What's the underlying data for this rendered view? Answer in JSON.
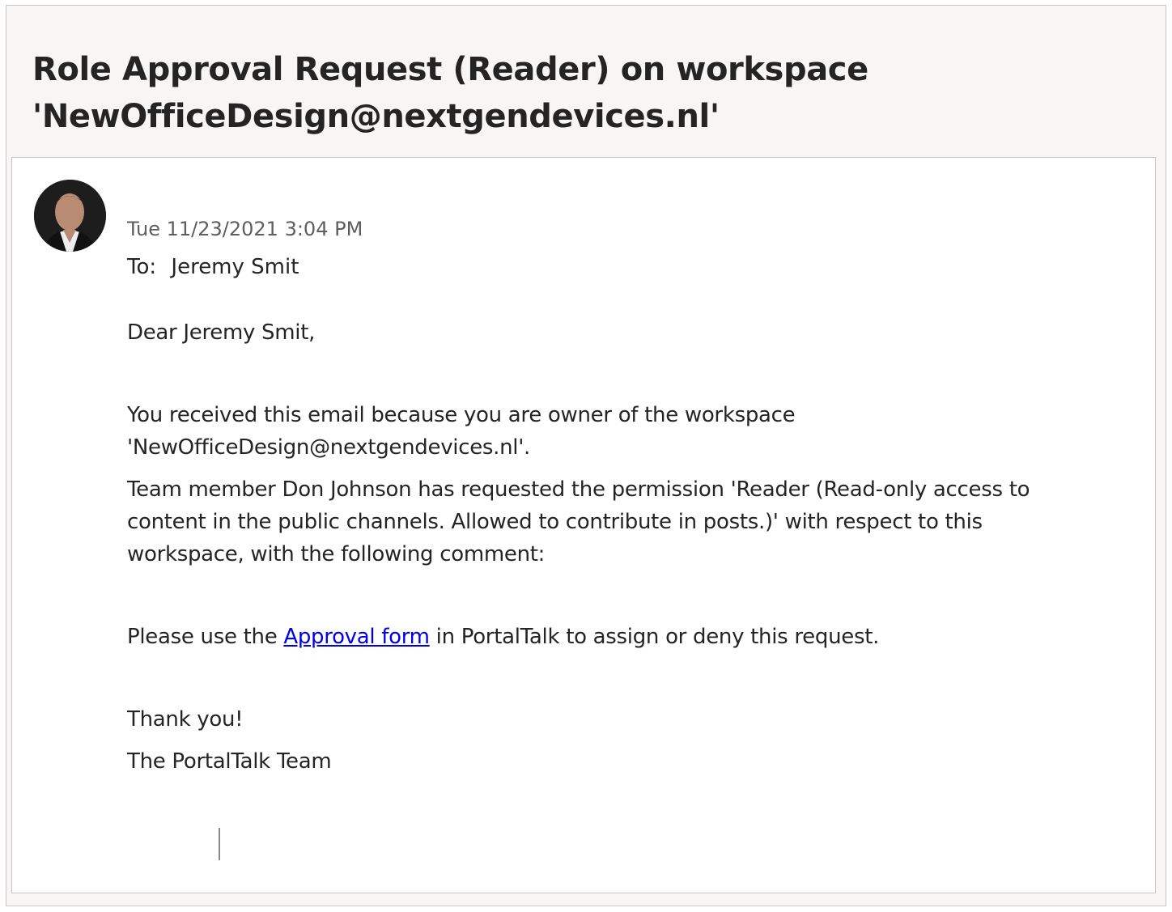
{
  "email": {
    "subject_line1": "Role Approval Request (Reader) on workspace",
    "subject_line2": "'NewOfficeDesign@nextgendevices.nl'",
    "timestamp": "Tue 11/23/2021 3:04 PM",
    "to_label": "To:",
    "to_name": "Jeremy Smit",
    "body": {
      "greeting": "Dear Jeremy Smit,",
      "received_line1": "You received this email because you are owner of the workspace",
      "received_line2": "'NewOfficeDesign@nextgendevices.nl'.",
      "permission_line1": "Team member Don Johnson has requested the permission 'Reader (Read-only access to",
      "permission_line2": "content in the public channels. Allowed to contribute in posts.)' with respect to this",
      "permission_line3": "workspace, with the following comment:",
      "instructions_before": "Please use the ",
      "instructions_link": "Approval form",
      "instructions_after": " in PortalTalk to assign or deny this request.",
      "thanks": "Thank you!",
      "signature": "The PortalTalk Team"
    }
  },
  "colors": {
    "link": "#0000ee",
    "text": "#242424",
    "muted": "#605e5c",
    "header_bg": "#f7f6f5"
  }
}
